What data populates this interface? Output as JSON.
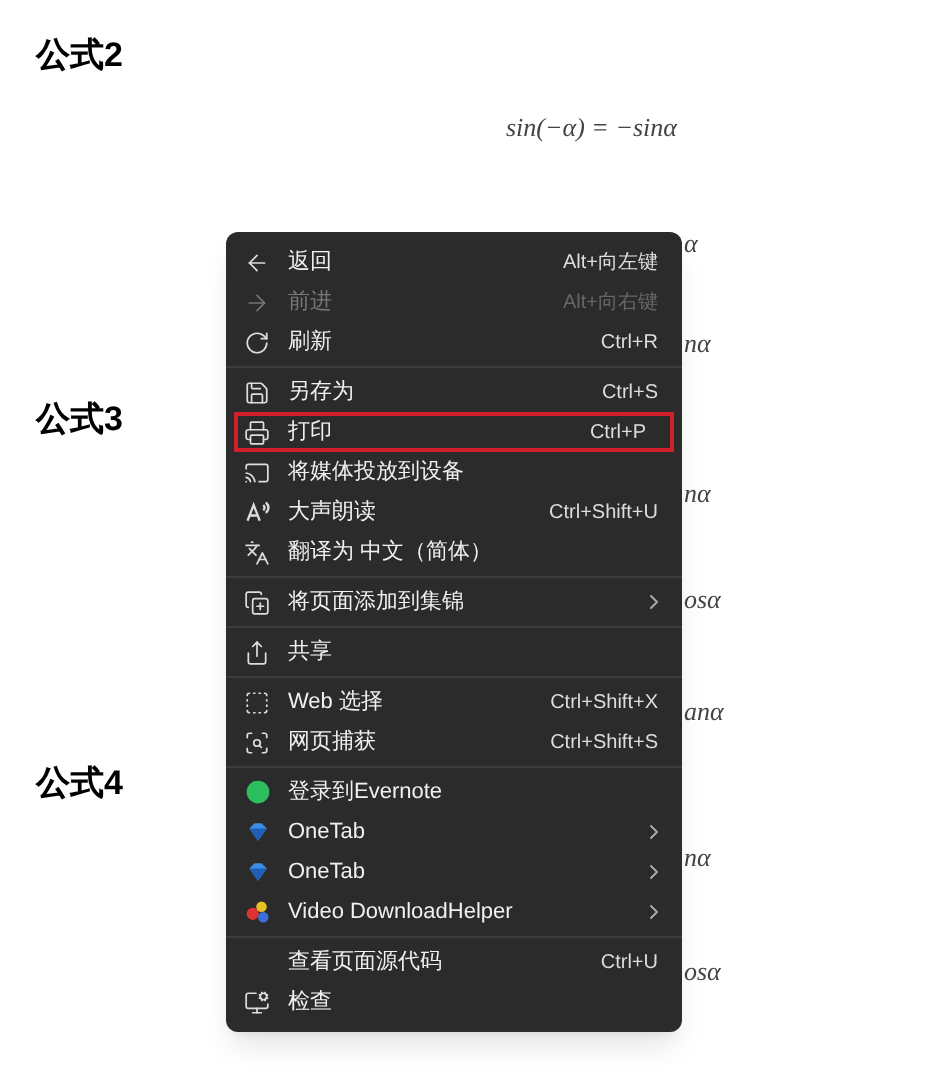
{
  "document": {
    "sections": [
      {
        "heading": "公式2",
        "formula": "sin(−α) = −sinα"
      },
      {
        "heading": "公式3"
      },
      {
        "heading": "公式4"
      }
    ],
    "formula_fragments": [
      "α",
      "nα",
      "nα",
      "osα",
      "anα",
      "nα",
      "osα"
    ]
  },
  "context_menu": {
    "groups": [
      [
        {
          "label": "返回",
          "shortcut": "Alt+向左键",
          "disabled": false,
          "submenu": false,
          "highlighted": false
        },
        {
          "label": "前进",
          "shortcut": "Alt+向右键",
          "disabled": true,
          "submenu": false,
          "highlighted": false
        },
        {
          "label": "刷新",
          "shortcut": "Ctrl+R",
          "disabled": false,
          "submenu": false,
          "highlighted": false
        }
      ],
      [
        {
          "label": "另存为",
          "shortcut": "Ctrl+S",
          "disabled": false,
          "submenu": false,
          "highlighted": false
        },
        {
          "label": "打印",
          "shortcut": "Ctrl+P",
          "disabled": false,
          "submenu": false,
          "highlighted": true
        },
        {
          "label": "将媒体投放到设备",
          "disabled": false,
          "submenu": false,
          "highlighted": false
        },
        {
          "label": "大声朗读",
          "shortcut": "Ctrl+Shift+U",
          "disabled": false,
          "submenu": false,
          "highlighted": false
        },
        {
          "label": "翻译为 中文（简体）",
          "disabled": false,
          "submenu": false,
          "highlighted": false
        }
      ],
      [
        {
          "label": "将页面添加到集锦",
          "disabled": false,
          "submenu": true,
          "highlighted": false
        }
      ],
      [
        {
          "label": "共享",
          "disabled": false,
          "submenu": false,
          "highlighted": false
        }
      ],
      [
        {
          "label": "Web 选择",
          "shortcut": "Ctrl+Shift+X",
          "disabled": false,
          "submenu": false,
          "highlighted": false
        },
        {
          "label": "网页捕获",
          "shortcut": "Ctrl+Shift+S",
          "disabled": false,
          "submenu": false,
          "highlighted": false
        }
      ],
      [
        {
          "label": "登录到Evernote",
          "disabled": false,
          "submenu": false,
          "highlighted": false
        },
        {
          "label": "OneTab",
          "disabled": false,
          "submenu": true,
          "highlighted": false
        },
        {
          "label": "OneTab",
          "disabled": false,
          "submenu": true,
          "highlighted": false
        },
        {
          "label": "Video DownloadHelper",
          "disabled": false,
          "submenu": true,
          "highlighted": false
        }
      ],
      [
        {
          "label": "查看页面源代码",
          "shortcut": "Ctrl+U",
          "disabled": false,
          "submenu": false,
          "highlighted": false
        },
        {
          "label": "检查",
          "disabled": false,
          "submenu": false,
          "highlighted": false
        }
      ]
    ]
  }
}
